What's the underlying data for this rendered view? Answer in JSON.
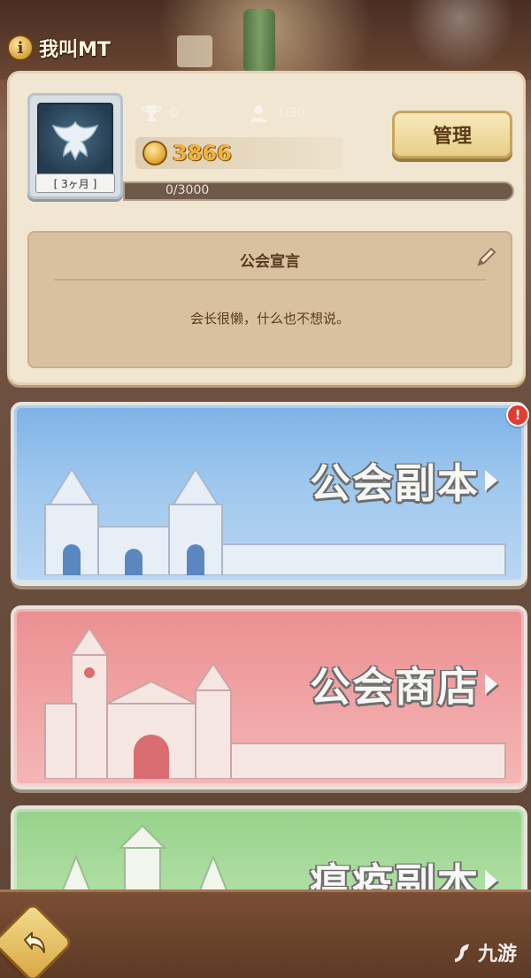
{
  "guild": {
    "name": "我叫MT",
    "info_icon_glyph": "i",
    "emblem_level": "[ 3ヶ月 ]",
    "trophy_count": "0",
    "member_count": "1/30",
    "gold": "3866",
    "exp": {
      "current": 0,
      "max": 3000,
      "label": "0/3000"
    },
    "manage_label": "管理"
  },
  "declaration": {
    "title": "公会宣言",
    "text": "会长很懒，什么也不想说。"
  },
  "banners": [
    {
      "title": "公会副本",
      "theme": "blue",
      "has_alert": true,
      "alert": "!"
    },
    {
      "title": "公会商店",
      "theme": "pink",
      "has_alert": false
    },
    {
      "title": "瘟疫副本",
      "theme": "green",
      "has_alert": false
    }
  ],
  "watermark": "九游",
  "colors": {
    "panel_bg": "#f0e6d2",
    "gold": "#f2b23a",
    "dungeon_banner": "#7fb2e6",
    "shop_banner": "#ec8f91",
    "plague_banner": "#96d28a",
    "alert_red": "#e23b32"
  }
}
